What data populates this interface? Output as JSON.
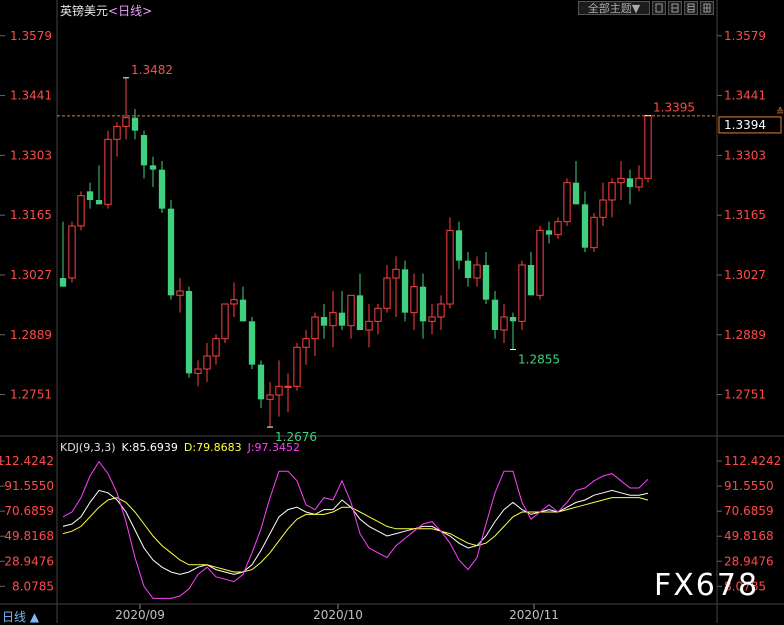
{
  "header": {
    "title": "英镑美元",
    "timeframe": "<日线>",
    "theme_label": "全部主题",
    "theme_arrow": "▼"
  },
  "indicator": {
    "name": "KDJ(9,3,3)",
    "k_label": "K:85.6939",
    "d_label": "D:79.8683",
    "j_label": "J:97.3452"
  },
  "footer": {
    "period_label": "日线 ▲",
    "watermark": "FX678"
  },
  "colors": {
    "up": "#ff4040",
    "down": "#40d080",
    "price_label": "#ff4a4a",
    "low_label": "#40d080",
    "k_line": "#ffffff",
    "d_line": "#ffff40",
    "j_line": "#ff40ff",
    "dashed_line": "#e08030"
  },
  "chart_data": [
    {
      "type": "candlestick",
      "title": "英镑美元",
      "x_labels": [
        "2020/09",
        "2020/10",
        "2020/11"
      ],
      "y_ticks": [
        "1.3579",
        "1.3441",
        "1.3303",
        "1.3165",
        "1.3027",
        "1.2889",
        "1.2751"
      ],
      "ylim": [
        1.266,
        1.362
      ],
      "annotations": {
        "high": "1.3482",
        "low_sept": "1.2676",
        "low_nov": "1.2855",
        "last_high": "1.3395",
        "current_price": "1.3394"
      },
      "current_price": 1.3394,
      "candles": [
        {
          "o": 1.302,
          "h": 1.315,
          "l": 1.301,
          "c": 1.3
        },
        {
          "o": 1.302,
          "h": 1.315,
          "l": 1.301,
          "c": 1.314
        },
        {
          "o": 1.314,
          "h": 1.322,
          "l": 1.313,
          "c": 1.321
        },
        {
          "o": 1.322,
          "h": 1.324,
          "l": 1.318,
          "c": 1.32
        },
        {
          "o": 1.32,
          "h": 1.328,
          "l": 1.319,
          "c": 1.319
        },
        {
          "o": 1.319,
          "h": 1.336,
          "l": 1.318,
          "c": 1.334
        },
        {
          "o": 1.334,
          "h": 1.338,
          "l": 1.33,
          "c": 1.337
        },
        {
          "o": 1.337,
          "h": 1.3482,
          "l": 1.334,
          "c": 1.339
        },
        {
          "o": 1.339,
          "h": 1.341,
          "l": 1.334,
          "c": 1.336
        },
        {
          "o": 1.335,
          "h": 1.336,
          "l": 1.325,
          "c": 1.328
        },
        {
          "o": 1.328,
          "h": 1.33,
          "l": 1.323,
          "c": 1.327
        },
        {
          "o": 1.327,
          "h": 1.329,
          "l": 1.317,
          "c": 1.318
        },
        {
          "o": 1.318,
          "h": 1.32,
          "l": 1.297,
          "c": 1.298
        },
        {
          "o": 1.298,
          "h": 1.302,
          "l": 1.294,
          "c": 1.299
        },
        {
          "o": 1.299,
          "h": 1.3,
          "l": 1.279,
          "c": 1.28
        },
        {
          "o": 1.28,
          "h": 1.283,
          "l": 1.277,
          "c": 1.281
        },
        {
          "o": 1.281,
          "h": 1.287,
          "l": 1.278,
          "c": 1.284
        },
        {
          "o": 1.284,
          "h": 1.289,
          "l": 1.282,
          "c": 1.288
        },
        {
          "o": 1.288,
          "h": 1.296,
          "l": 1.287,
          "c": 1.296
        },
        {
          "o": 1.296,
          "h": 1.301,
          "l": 1.293,
          "c": 1.297
        },
        {
          "o": 1.297,
          "h": 1.3,
          "l": 1.292,
          "c": 1.292
        },
        {
          "o": 1.292,
          "h": 1.293,
          "l": 1.281,
          "c": 1.282
        },
        {
          "o": 1.282,
          "h": 1.283,
          "l": 1.272,
          "c": 1.274
        },
        {
          "o": 1.274,
          "h": 1.278,
          "l": 1.2676,
          "c": 1.275
        },
        {
          "o": 1.275,
          "h": 1.283,
          "l": 1.27,
          "c": 1.277
        },
        {
          "o": 1.277,
          "h": 1.28,
          "l": 1.271,
          "c": 1.277
        },
        {
          "o": 1.277,
          "h": 1.287,
          "l": 1.276,
          "c": 1.286
        },
        {
          "o": 1.286,
          "h": 1.29,
          "l": 1.282,
          "c": 1.288
        },
        {
          "o": 1.288,
          "h": 1.294,
          "l": 1.284,
          "c": 1.293
        },
        {
          "o": 1.293,
          "h": 1.296,
          "l": 1.288,
          "c": 1.291
        },
        {
          "o": 1.291,
          "h": 1.299,
          "l": 1.286,
          "c": 1.294
        },
        {
          "o": 1.294,
          "h": 1.299,
          "l": 1.29,
          "c": 1.291
        },
        {
          "o": 1.291,
          "h": 1.298,
          "l": 1.288,
          "c": 1.298
        },
        {
          "o": 1.298,
          "h": 1.303,
          "l": 1.295,
          "c": 1.29
        },
        {
          "o": 1.29,
          "h": 1.296,
          "l": 1.286,
          "c": 1.292
        },
        {
          "o": 1.292,
          "h": 1.296,
          "l": 1.289,
          "c": 1.295
        },
        {
          "o": 1.295,
          "h": 1.305,
          "l": 1.294,
          "c": 1.302
        },
        {
          "o": 1.302,
          "h": 1.307,
          "l": 1.293,
          "c": 1.304
        },
        {
          "o": 1.304,
          "h": 1.306,
          "l": 1.292,
          "c": 1.294
        },
        {
          "o": 1.294,
          "h": 1.303,
          "l": 1.29,
          "c": 1.3
        },
        {
          "o": 1.3,
          "h": 1.303,
          "l": 1.288,
          "c": 1.292
        },
        {
          "o": 1.292,
          "h": 1.296,
          "l": 1.289,
          "c": 1.293
        },
        {
          "o": 1.293,
          "h": 1.298,
          "l": 1.29,
          "c": 1.296
        },
        {
          "o": 1.296,
          "h": 1.316,
          "l": 1.295,
          "c": 1.313
        },
        {
          "o": 1.313,
          "h": 1.315,
          "l": 1.304,
          "c": 1.306
        },
        {
          "o": 1.306,
          "h": 1.308,
          "l": 1.3,
          "c": 1.302
        },
        {
          "o": 1.302,
          "h": 1.307,
          "l": 1.3,
          "c": 1.305
        },
        {
          "o": 1.305,
          "h": 1.308,
          "l": 1.296,
          "c": 1.297
        },
        {
          "o": 1.297,
          "h": 1.299,
          "l": 1.288,
          "c": 1.29
        },
        {
          "o": 1.29,
          "h": 1.296,
          "l": 1.287,
          "c": 1.293
        },
        {
          "o": 1.293,
          "h": 1.294,
          "l": 1.2855,
          "c": 1.292
        },
        {
          "o": 1.292,
          "h": 1.306,
          "l": 1.29,
          "c": 1.305
        },
        {
          "o": 1.305,
          "h": 1.308,
          "l": 1.298,
          "c": 1.298
        },
        {
          "o": 1.298,
          "h": 1.314,
          "l": 1.297,
          "c": 1.313
        },
        {
          "o": 1.313,
          "h": 1.315,
          "l": 1.31,
          "c": 1.312
        },
        {
          "o": 1.312,
          "h": 1.316,
          "l": 1.311,
          "c": 1.315
        },
        {
          "o": 1.315,
          "h": 1.325,
          "l": 1.314,
          "c": 1.324
        },
        {
          "o": 1.324,
          "h": 1.329,
          "l": 1.319,
          "c": 1.319
        },
        {
          "o": 1.319,
          "h": 1.322,
          "l": 1.308,
          "c": 1.309
        },
        {
          "o": 1.309,
          "h": 1.317,
          "l": 1.308,
          "c": 1.316
        },
        {
          "o": 1.316,
          "h": 1.324,
          "l": 1.314,
          "c": 1.32
        },
        {
          "o": 1.32,
          "h": 1.325,
          "l": 1.316,
          "c": 1.324
        },
        {
          "o": 1.324,
          "h": 1.329,
          "l": 1.32,
          "c": 1.325
        },
        {
          "o": 1.325,
          "h": 1.327,
          "l": 1.319,
          "c": 1.323
        },
        {
          "o": 1.323,
          "h": 1.328,
          "l": 1.322,
          "c": 1.325
        },
        {
          "o": 1.325,
          "h": 1.3395,
          "l": 1.324,
          "c": 1.3394
        }
      ]
    },
    {
      "type": "line",
      "title": "KDJ(9,3,3)",
      "y_ticks": [
        "112.4242",
        "91.5550",
        "70.6859",
        "49.8168",
        "28.9476",
        "8.0785"
      ],
      "ylim": [
        -5,
        120
      ],
      "series": [
        {
          "name": "K",
          "values": [
            58,
            60,
            66,
            78,
            88,
            86,
            80,
            70,
            55,
            40,
            30,
            24,
            20,
            18,
            20,
            24,
            26,
            22,
            20,
            18,
            20,
            26,
            38,
            52,
            66,
            72,
            74,
            70,
            68,
            72,
            72,
            80,
            74,
            64,
            58,
            54,
            50,
            52,
            54,
            56,
            58,
            58,
            54,
            50,
            44,
            40,
            42,
            50,
            62,
            72,
            78,
            72,
            68,
            70,
            72,
            70,
            74,
            78,
            80,
            84,
            86,
            88,
            86,
            84,
            84,
            85.7
          ]
        },
        {
          "name": "D",
          "values": [
            52,
            54,
            58,
            66,
            74,
            80,
            82,
            78,
            70,
            60,
            50,
            42,
            36,
            30,
            26,
            26,
            26,
            24,
            22,
            20,
            20,
            22,
            28,
            36,
            46,
            56,
            64,
            68,
            68,
            68,
            70,
            74,
            74,
            70,
            66,
            62,
            58,
            56,
            56,
            56,
            56,
            56,
            54,
            52,
            48,
            44,
            42,
            44,
            50,
            58,
            66,
            70,
            70,
            70,
            70,
            70,
            72,
            74,
            76,
            78,
            80,
            82,
            82,
            82,
            82,
            79.9
          ]
        },
        {
          "name": "J",
          "values": [
            66,
            70,
            82,
            100,
            112,
            102,
            86,
            62,
            32,
            8,
            -2,
            -2,
            -2,
            0,
            6,
            18,
            24,
            16,
            14,
            12,
            18,
            36,
            56,
            82,
            104,
            104,
            96,
            76,
            72,
            82,
            80,
            96,
            78,
            52,
            40,
            36,
            32,
            42,
            48,
            54,
            60,
            62,
            54,
            44,
            30,
            22,
            32,
            60,
            86,
            104,
            104,
            78,
            64,
            70,
            76,
            70,
            78,
            88,
            90,
            96,
            100,
            102,
            96,
            90,
            90,
            97.3
          ]
        }
      ]
    }
  ]
}
